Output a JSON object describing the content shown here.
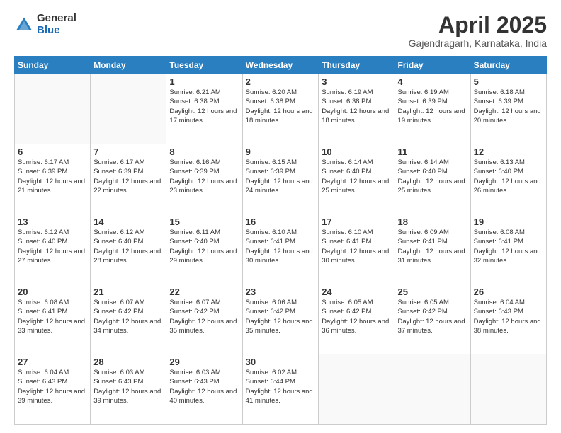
{
  "logo": {
    "general": "General",
    "blue": "Blue"
  },
  "title": "April 2025",
  "subtitle": "Gajendragarh, Karnataka, India",
  "days_header": [
    "Sunday",
    "Monday",
    "Tuesday",
    "Wednesday",
    "Thursday",
    "Friday",
    "Saturday"
  ],
  "weeks": [
    [
      {
        "day": "",
        "sunrise": "",
        "sunset": "",
        "daylight": "",
        "empty": true
      },
      {
        "day": "",
        "sunrise": "",
        "sunset": "",
        "daylight": "",
        "empty": true
      },
      {
        "day": "1",
        "sunrise": "Sunrise: 6:21 AM",
        "sunset": "Sunset: 6:38 PM",
        "daylight": "Daylight: 12 hours and 17 minutes."
      },
      {
        "day": "2",
        "sunrise": "Sunrise: 6:20 AM",
        "sunset": "Sunset: 6:38 PM",
        "daylight": "Daylight: 12 hours and 18 minutes."
      },
      {
        "day": "3",
        "sunrise": "Sunrise: 6:19 AM",
        "sunset": "Sunset: 6:38 PM",
        "daylight": "Daylight: 12 hours and 18 minutes."
      },
      {
        "day": "4",
        "sunrise": "Sunrise: 6:19 AM",
        "sunset": "Sunset: 6:39 PM",
        "daylight": "Daylight: 12 hours and 19 minutes."
      },
      {
        "day": "5",
        "sunrise": "Sunrise: 6:18 AM",
        "sunset": "Sunset: 6:39 PM",
        "daylight": "Daylight: 12 hours and 20 minutes."
      }
    ],
    [
      {
        "day": "6",
        "sunrise": "Sunrise: 6:17 AM",
        "sunset": "Sunset: 6:39 PM",
        "daylight": "Daylight: 12 hours and 21 minutes."
      },
      {
        "day": "7",
        "sunrise": "Sunrise: 6:17 AM",
        "sunset": "Sunset: 6:39 PM",
        "daylight": "Daylight: 12 hours and 22 minutes."
      },
      {
        "day": "8",
        "sunrise": "Sunrise: 6:16 AM",
        "sunset": "Sunset: 6:39 PM",
        "daylight": "Daylight: 12 hours and 23 minutes."
      },
      {
        "day": "9",
        "sunrise": "Sunrise: 6:15 AM",
        "sunset": "Sunset: 6:39 PM",
        "daylight": "Daylight: 12 hours and 24 minutes."
      },
      {
        "day": "10",
        "sunrise": "Sunrise: 6:14 AM",
        "sunset": "Sunset: 6:40 PM",
        "daylight": "Daylight: 12 hours and 25 minutes."
      },
      {
        "day": "11",
        "sunrise": "Sunrise: 6:14 AM",
        "sunset": "Sunset: 6:40 PM",
        "daylight": "Daylight: 12 hours and 25 minutes."
      },
      {
        "day": "12",
        "sunrise": "Sunrise: 6:13 AM",
        "sunset": "Sunset: 6:40 PM",
        "daylight": "Daylight: 12 hours and 26 minutes."
      }
    ],
    [
      {
        "day": "13",
        "sunrise": "Sunrise: 6:12 AM",
        "sunset": "Sunset: 6:40 PM",
        "daylight": "Daylight: 12 hours and 27 minutes."
      },
      {
        "day": "14",
        "sunrise": "Sunrise: 6:12 AM",
        "sunset": "Sunset: 6:40 PM",
        "daylight": "Daylight: 12 hours and 28 minutes."
      },
      {
        "day": "15",
        "sunrise": "Sunrise: 6:11 AM",
        "sunset": "Sunset: 6:40 PM",
        "daylight": "Daylight: 12 hours and 29 minutes."
      },
      {
        "day": "16",
        "sunrise": "Sunrise: 6:10 AM",
        "sunset": "Sunset: 6:41 PM",
        "daylight": "Daylight: 12 hours and 30 minutes."
      },
      {
        "day": "17",
        "sunrise": "Sunrise: 6:10 AM",
        "sunset": "Sunset: 6:41 PM",
        "daylight": "Daylight: 12 hours and 30 minutes."
      },
      {
        "day": "18",
        "sunrise": "Sunrise: 6:09 AM",
        "sunset": "Sunset: 6:41 PM",
        "daylight": "Daylight: 12 hours and 31 minutes."
      },
      {
        "day": "19",
        "sunrise": "Sunrise: 6:08 AM",
        "sunset": "Sunset: 6:41 PM",
        "daylight": "Daylight: 12 hours and 32 minutes."
      }
    ],
    [
      {
        "day": "20",
        "sunrise": "Sunrise: 6:08 AM",
        "sunset": "Sunset: 6:41 PM",
        "daylight": "Daylight: 12 hours and 33 minutes."
      },
      {
        "day": "21",
        "sunrise": "Sunrise: 6:07 AM",
        "sunset": "Sunset: 6:42 PM",
        "daylight": "Daylight: 12 hours and 34 minutes."
      },
      {
        "day": "22",
        "sunrise": "Sunrise: 6:07 AM",
        "sunset": "Sunset: 6:42 PM",
        "daylight": "Daylight: 12 hours and 35 minutes."
      },
      {
        "day": "23",
        "sunrise": "Sunrise: 6:06 AM",
        "sunset": "Sunset: 6:42 PM",
        "daylight": "Daylight: 12 hours and 35 minutes."
      },
      {
        "day": "24",
        "sunrise": "Sunrise: 6:05 AM",
        "sunset": "Sunset: 6:42 PM",
        "daylight": "Daylight: 12 hours and 36 minutes."
      },
      {
        "day": "25",
        "sunrise": "Sunrise: 6:05 AM",
        "sunset": "Sunset: 6:42 PM",
        "daylight": "Daylight: 12 hours and 37 minutes."
      },
      {
        "day": "26",
        "sunrise": "Sunrise: 6:04 AM",
        "sunset": "Sunset: 6:43 PM",
        "daylight": "Daylight: 12 hours and 38 minutes."
      }
    ],
    [
      {
        "day": "27",
        "sunrise": "Sunrise: 6:04 AM",
        "sunset": "Sunset: 6:43 PM",
        "daylight": "Daylight: 12 hours and 39 minutes."
      },
      {
        "day": "28",
        "sunrise": "Sunrise: 6:03 AM",
        "sunset": "Sunset: 6:43 PM",
        "daylight": "Daylight: 12 hours and 39 minutes."
      },
      {
        "day": "29",
        "sunrise": "Sunrise: 6:03 AM",
        "sunset": "Sunset: 6:43 PM",
        "daylight": "Daylight: 12 hours and 40 minutes."
      },
      {
        "day": "30",
        "sunrise": "Sunrise: 6:02 AM",
        "sunset": "Sunset: 6:44 PM",
        "daylight": "Daylight: 12 hours and 41 minutes."
      },
      {
        "day": "",
        "sunrise": "",
        "sunset": "",
        "daylight": "",
        "empty": true
      },
      {
        "day": "",
        "sunrise": "",
        "sunset": "",
        "daylight": "",
        "empty": true
      },
      {
        "day": "",
        "sunrise": "",
        "sunset": "",
        "daylight": "",
        "empty": true
      }
    ]
  ]
}
